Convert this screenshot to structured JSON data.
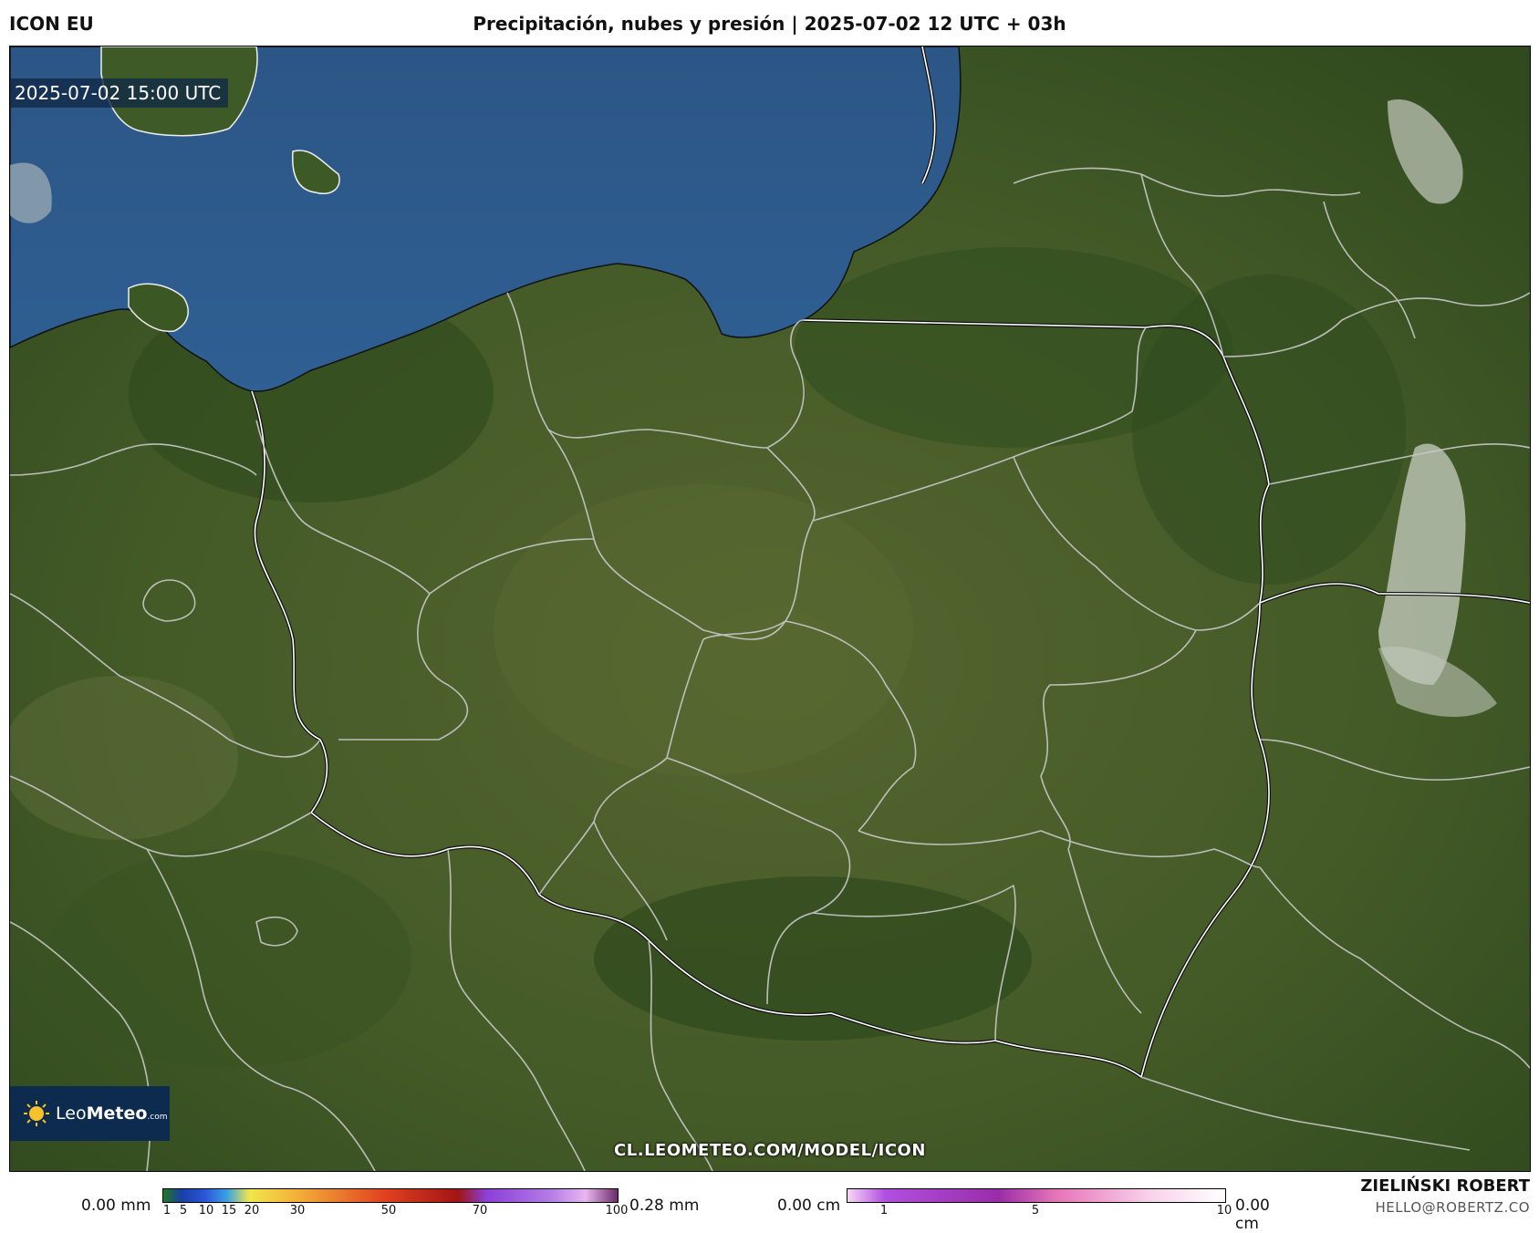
{
  "header": {
    "model": "ICON EU",
    "title": "Precipitación, nubes y presión | 2025-07-02 12 UTC + 03h"
  },
  "map": {
    "valid_time": "2025-07-02 15:00 UTC",
    "watermark": "CL.LEOMETEO.COM/MODEL/ICON",
    "logo_text_1": "Leo",
    "logo_text_2": "Meteo",
    "logo_text_3": ".com",
    "sea_color": "#2e5b8c",
    "land_color": "#3f5524",
    "border_color": "#d9d9d9"
  },
  "precip_legend": {
    "min_label": "0.00 mm",
    "max_label": "0.28 mm",
    "ticks": [
      "1",
      "5",
      "10",
      "15",
      "20",
      "30",
      "50",
      "70",
      "100"
    ]
  },
  "snow_legend": {
    "min_label": "0.00 cm",
    "max_label": "0.00 cm",
    "ticks": [
      "1",
      "5",
      "10"
    ]
  },
  "author": {
    "name": "ZIELIŃSKI ROBERT",
    "email": "HELLO@ROBERTZ.CO"
  }
}
